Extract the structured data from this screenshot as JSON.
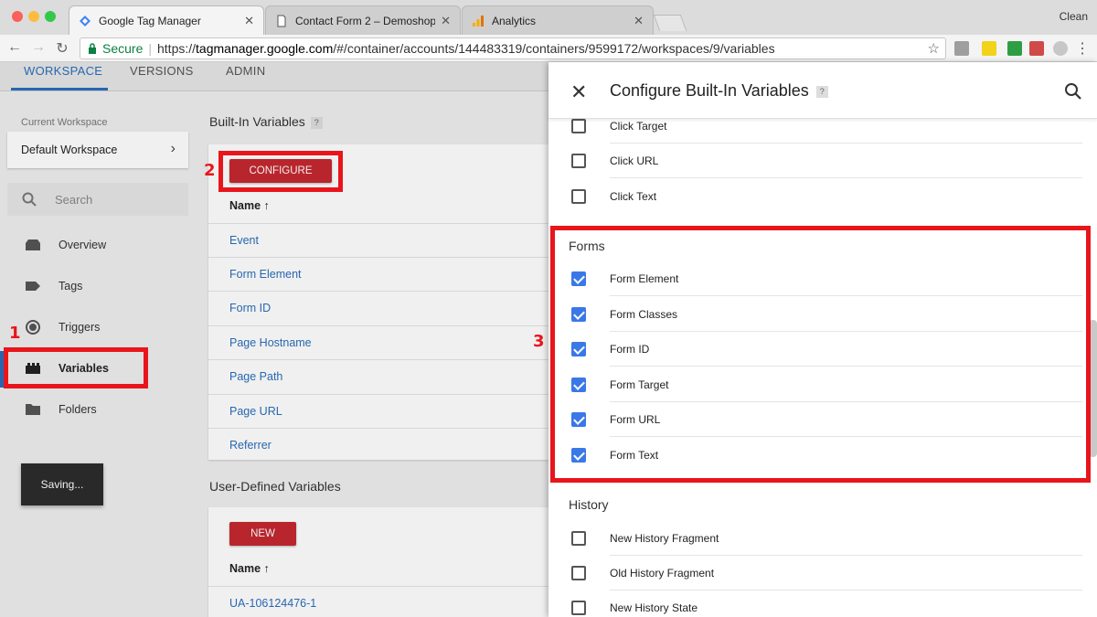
{
  "browser": {
    "tabs": [
      {
        "title": "Google Tag Manager",
        "active": true
      },
      {
        "title": "Contact Form 2 – Demoshop",
        "active": false
      },
      {
        "title": "Analytics",
        "active": false
      }
    ],
    "profile": "Clean",
    "secure_label": "Secure",
    "url_prefix": "https://",
    "url_host": "tagmanager.google.com",
    "url_path": "/#/container/accounts/144483319/containers/9599172/workspaces/9/variables"
  },
  "gtm": {
    "tabs": [
      "WORKSPACE",
      "VERSIONS",
      "ADMIN"
    ],
    "current_workspace_label": "Current Workspace",
    "workspace_name": "Default Workspace",
    "search_placeholder": "Search",
    "nav": [
      "Overview",
      "Tags",
      "Triggers",
      "Variables",
      "Folders"
    ],
    "active_nav": "Variables",
    "saving_text": "Saving...",
    "builtin": {
      "title": "Built-In Variables",
      "help": "?",
      "configure_label": "CONFIGURE",
      "col_name": "Name ↑",
      "rows": [
        "Event",
        "Form Element",
        "Form ID",
        "Page Hostname",
        "Page Path",
        "Page URL",
        "Referrer"
      ]
    },
    "userdefined": {
      "title": "User-Defined Variables",
      "new_label": "NEW",
      "col_name": "Name ↑",
      "rows": [
        "UA-106124476-1"
      ]
    }
  },
  "panel": {
    "title": "Configure Built-In Variables",
    "help": "?",
    "clicks_rows": [
      {
        "label": "Click Target",
        "checked": false
      },
      {
        "label": "Click URL",
        "checked": false
      },
      {
        "label": "Click Text",
        "checked": false
      }
    ],
    "forms_title": "Forms",
    "forms_rows": [
      {
        "label": "Form Element",
        "checked": true
      },
      {
        "label": "Form Classes",
        "checked": true
      },
      {
        "label": "Form ID",
        "checked": true
      },
      {
        "label": "Form Target",
        "checked": true
      },
      {
        "label": "Form URL",
        "checked": true
      },
      {
        "label": "Form Text",
        "checked": true
      }
    ],
    "history_title": "History",
    "history_rows": [
      {
        "label": "New History Fragment",
        "checked": false
      },
      {
        "label": "Old History Fragment",
        "checked": false
      },
      {
        "label": "New History State",
        "checked": false
      }
    ]
  },
  "annotations": [
    "1",
    "2",
    "3"
  ],
  "colors": {
    "accent": "#2a6ebb",
    "button_red": "#c5282f",
    "annotation_red": "#e8151b",
    "checkbox_blue": "#3b78e7"
  }
}
